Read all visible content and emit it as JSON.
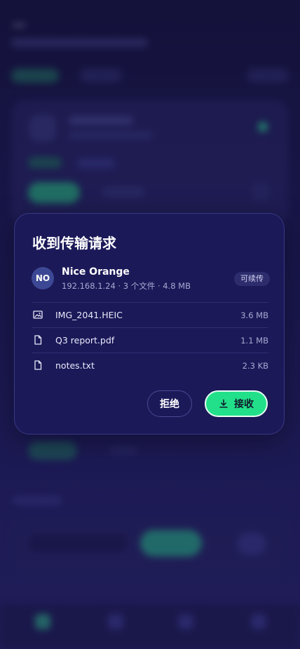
{
  "dialog": {
    "title": "收到传输请求",
    "sender": {
      "initials": "NO",
      "name": "Nice Orange",
      "meta": "192.168.1.24 · 3 个文件 · 4.8 MB",
      "badge": "可续传"
    },
    "files": [
      {
        "name": "IMG_2041.HEIC",
        "size": "3.6 MB",
        "icon": "image-icon"
      },
      {
        "name": "Q3 report.pdf",
        "size": "1.1 MB",
        "icon": "file-icon"
      },
      {
        "name": "notes.txt",
        "size": "2.3 KB",
        "icon": "file-icon"
      }
    ],
    "reject_label": "拒绝",
    "accept_label": "接收",
    "accept_icon": "download-icon"
  },
  "colors": {
    "accent_green": "#22e089",
    "dialog_bg": "#1b1958",
    "page_bg": "#14123a",
    "muted_text": "#a8a9d2"
  }
}
